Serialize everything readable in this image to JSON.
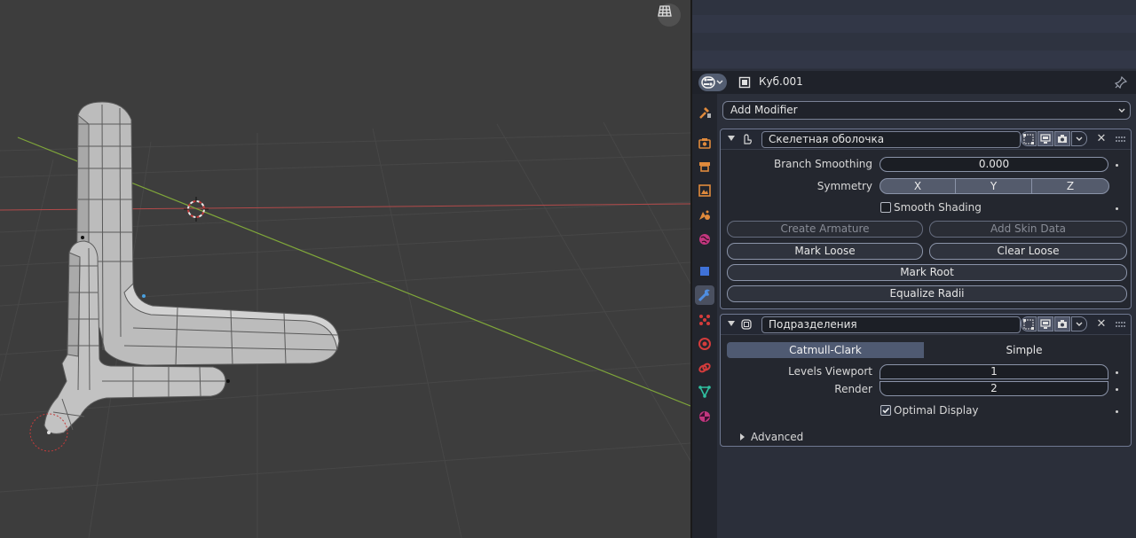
{
  "properties": {
    "object_name": "Куб.001",
    "add_modifier_label": "Add Modifier"
  },
  "modifiers": [
    {
      "name": "Скелетная оболочка",
      "branch_smoothing_label": "Branch Smoothing",
      "branch_smoothing_value": "0.000",
      "symmetry_label": "Symmetry",
      "symmetry_options": [
        "X",
        "Y",
        "Z"
      ],
      "smooth_shading_label": "Smooth Shading",
      "smooth_shading_checked": false,
      "create_armature_label": "Create Armature",
      "add_skin_data_label": "Add Skin Data",
      "mark_loose_label": "Mark Loose",
      "clear_loose_label": "Clear Loose",
      "mark_root_label": "Mark Root",
      "equalize_radii_label": "Equalize Radii"
    },
    {
      "name": "Подразделения",
      "mode_options": [
        "Catmull-Clark",
        "Simple"
      ],
      "mode_selected": "Catmull-Clark",
      "levels_viewport_label": "Levels Viewport",
      "levels_viewport_value": "1",
      "render_label": "Render",
      "render_value": "2",
      "optimal_display_label": "Optimal Display",
      "optimal_display_checked": true,
      "advanced_label": "Advanced"
    }
  ],
  "colors": {
    "viewport_bg": "#3d3d3d",
    "x_axis": "#b34a4a",
    "y_axis": "#7fa63a",
    "panel_bg": "#24272f",
    "accent": "#4f5a72"
  },
  "icons": [
    "grid-view-icon",
    "editor-type-icon",
    "object-icon",
    "pin-icon",
    "tool-tab-icon",
    "render-tab-icon",
    "output-tab-icon",
    "view-layer-tab-icon",
    "scene-tab-icon",
    "world-tab-icon",
    "object-tab-icon",
    "modifier-tab-icon",
    "particles-tab-icon",
    "physics-tab-icon",
    "constraints-tab-icon",
    "data-tab-icon",
    "material-tab-icon"
  ]
}
